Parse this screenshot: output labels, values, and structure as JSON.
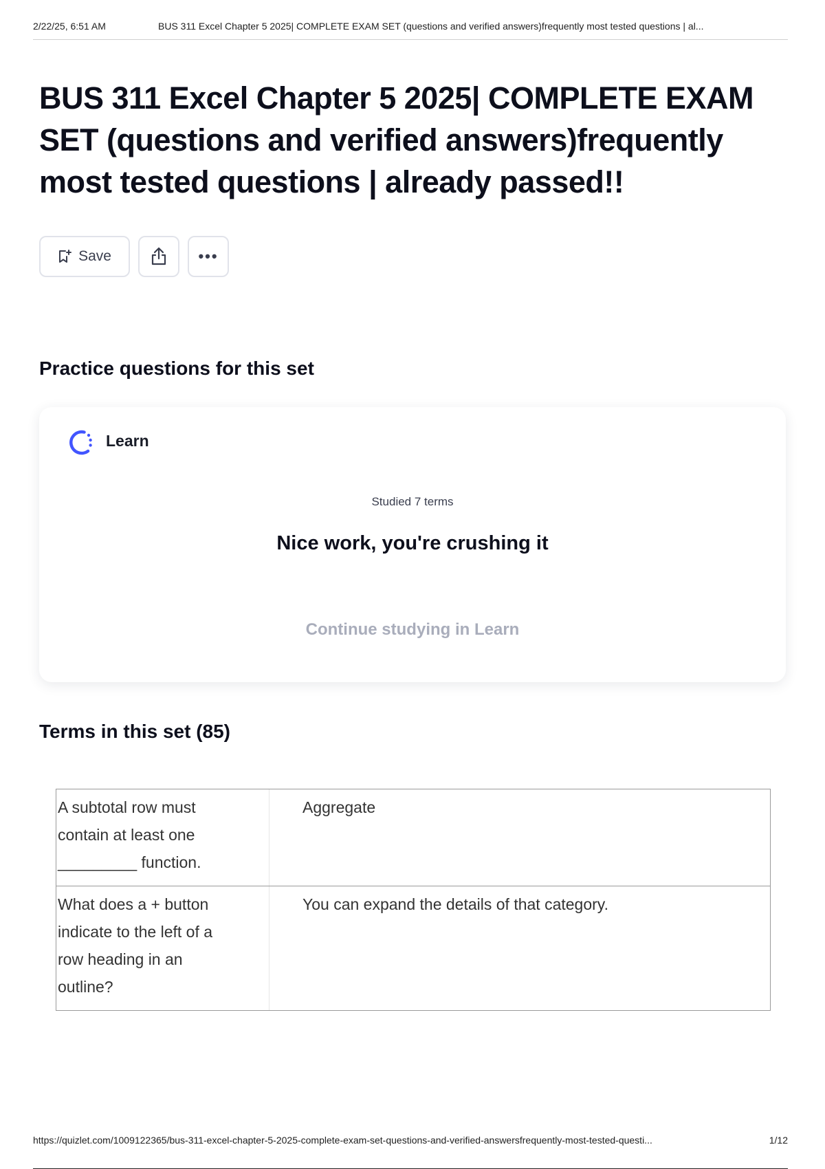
{
  "print_header": {
    "datetime": "2/22/25, 6:51 AM",
    "title": "BUS 311 Excel Chapter 5 2025| COMPLETE EXAM SET (questions and verified answers)frequently most tested questions | al..."
  },
  "page_title": "BUS 311 Excel Chapter 5 2025| COMPLETE EXAM SET (questions and verified answers)frequently most tested questions | already passed!!",
  "toolbar": {
    "save_label": "Save",
    "more_label": "•••",
    "icons": [
      "bookmark-add-icon",
      "share-icon",
      "more-icon"
    ]
  },
  "practice": {
    "heading": "Practice questions for this set",
    "learn_label": "Learn",
    "studied_text": "Studied 7 terms",
    "encouragement": "Nice work, you're crushing it",
    "continue_label": "Continue studying in Learn",
    "accent_color": "#4255ff"
  },
  "terms": {
    "heading": "Terms in this set (85)",
    "rows": [
      {
        "question_lines": [
          "A subtotal row must",
          "contain at least one",
          "_________ function."
        ],
        "answer": "Aggregate"
      },
      {
        "question_lines": [
          "What does a + button",
          "indicate to the left of a",
          "row heading in an",
          "outline?"
        ],
        "answer": "You can expand the details of that category."
      }
    ]
  },
  "print_footer": {
    "url": "https://quizlet.com/1009122365/bus-311-excel-chapter-5-2025-complete-exam-set-questions-and-verified-answersfrequently-most-tested-questi...",
    "page": "1/12"
  }
}
